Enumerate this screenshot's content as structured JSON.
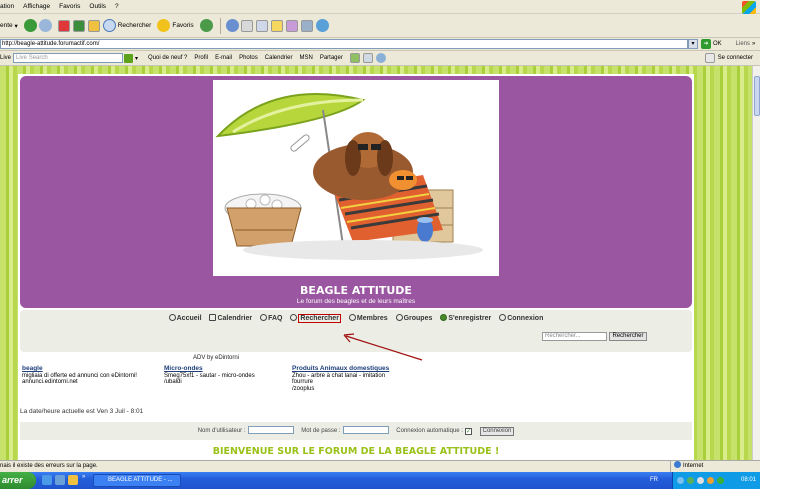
{
  "browser": {
    "menu": [
      "ation",
      "Affichage",
      "Favoris",
      "Outils",
      "?"
    ],
    "toolbar": {
      "back_label": "ente",
      "search_label": "Rechercher",
      "favorites_label": "Favoris"
    },
    "address": {
      "url": "http://beagle-attitude.forumactif.com/",
      "go_label": "OK",
      "links_label": "Liens"
    },
    "links_bar": {
      "live_label": "Live",
      "search_placeholder": "Live Search",
      "items": [
        "Quoi de neuf ?",
        "Profil",
        "E-mail",
        "Photos",
        "Calendrier",
        "MSN",
        "Partager"
      ],
      "connect_label": "Se connecter"
    },
    "status": "nais il existe des erreurs sur la page.",
    "zone": "Internet"
  },
  "forum": {
    "title": "BEAGLE ATTITUDE",
    "subtitle": "Le forum des beagles et de leurs maîtres",
    "nav": [
      "Accueil",
      "Calendrier",
      "FAQ",
      "Rechercher",
      "Membres",
      "Groupes",
      "S'enregistrer",
      "Connexion"
    ],
    "search": {
      "placeholder": "Rechercher...",
      "button": "Rechercher"
    },
    "adv_by": "ADV by eDintorni",
    "ads": [
      {
        "title": "beagle",
        "lines": [
          "migliaia di offerte ed annunci con eDintorni!",
          "annunci.edintorni.net"
        ]
      },
      {
        "title": "Micro-ondes",
        "lines": [
          "Smeg75xf1 - sautar - micro-ondes",
          "/ubaldi"
        ]
      },
      {
        "title": "Produits Animaux domestiques",
        "lines": [
          "Zhou - arbre à chat lanai - imitation",
          "fourrure",
          "/zooplus"
        ]
      }
    ],
    "datetime": "La date/heure actuelle est Ven 3 Juil - 8:01",
    "login": {
      "username_label": "Nom d'utilisateur :",
      "password_label": "Mot de passe :",
      "auto_label": "Connexion automatique :",
      "button": "Connexion"
    },
    "welcome": "BIENVENUE SUR LE FORUM DE LA BEAGLE ATTITUDE !"
  },
  "taskbar": {
    "start_label": "arrer",
    "task": "BEAGLE ATTITUDE - ...",
    "lang": "FR",
    "clock": "08:01"
  }
}
